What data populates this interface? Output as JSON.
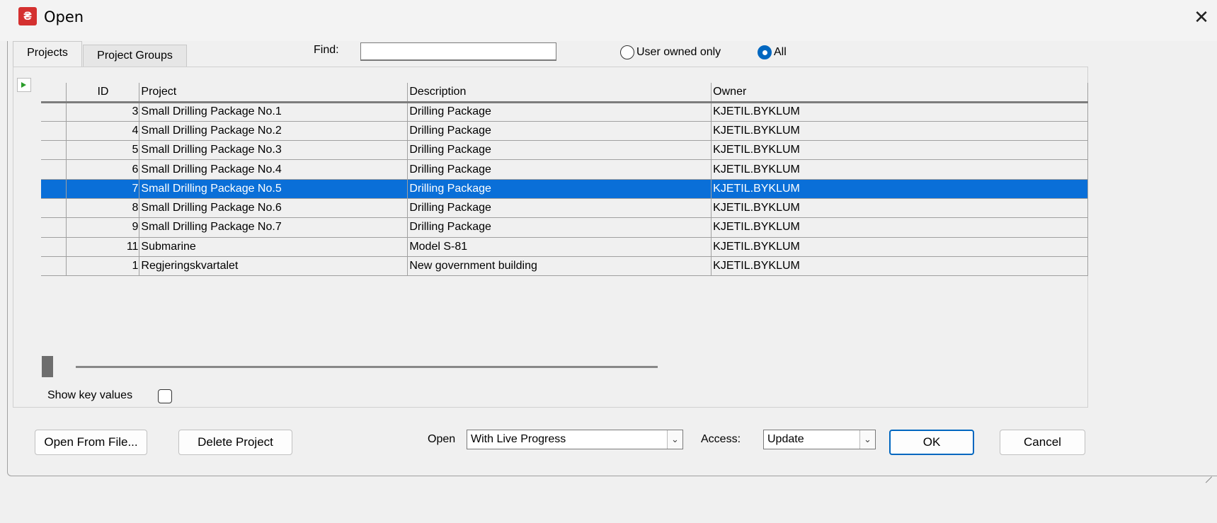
{
  "window": {
    "title": "Open",
    "app_icon_glyph": "₴",
    "close_glyph": "✕"
  },
  "tabs": [
    {
      "label": "Projects",
      "selected": true
    },
    {
      "label": "Project Groups",
      "selected": false
    }
  ],
  "find": {
    "label": "Find:",
    "value": ""
  },
  "filter": {
    "options": [
      {
        "label": "User owned only",
        "checked": false
      },
      {
        "label": "All",
        "checked": true
      }
    ]
  },
  "grid": {
    "columns": [
      "",
      "ID",
      "Project",
      "Description",
      "Owner"
    ],
    "rows": [
      {
        "id": "3",
        "project": "Small Drilling Package No.1",
        "description": "Drilling Package",
        "owner": "KJETIL.BYKLUM"
      },
      {
        "id": "4",
        "project": "Small Drilling Package No.2",
        "description": "Drilling Package",
        "owner": "KJETIL.BYKLUM"
      },
      {
        "id": "5",
        "project": "Small Drilling Package No.3",
        "description": "Drilling Package",
        "owner": "KJETIL.BYKLUM"
      },
      {
        "id": "6",
        "project": "Small Drilling Package No.4",
        "description": "Drilling Package",
        "owner": "KJETIL.BYKLUM"
      },
      {
        "id": "7",
        "project": "Small Drilling Package No.5",
        "description": "Drilling Package",
        "owner": "KJETIL.BYKLUM",
        "selected": true
      },
      {
        "id": "8",
        "project": "Small Drilling Package No.6",
        "description": "Drilling Package",
        "owner": "KJETIL.BYKLUM"
      },
      {
        "id": "9",
        "project": "Small Drilling Package No.7",
        "description": "Drilling Package",
        "owner": "KJETIL.BYKLUM"
      },
      {
        "id": "11",
        "project": "Submarine",
        "description": "Model S-81",
        "owner": "KJETIL.BYKLUM"
      },
      {
        "id": "1",
        "project": "Regjeringskvartalet",
        "description": "New government building",
        "owner": "KJETIL.BYKLUM"
      }
    ]
  },
  "show_key_values": {
    "label": "Show key values",
    "checked": false
  },
  "buttons": {
    "open_from_file": "Open From File...",
    "delete_project": "Delete Project",
    "ok": "OK",
    "cancel": "Cancel"
  },
  "open_mode": {
    "label": "Open",
    "value": "With Live Progress"
  },
  "access": {
    "label": "Access:",
    "value": "Update"
  },
  "colors": {
    "selection": "#0a6fd8",
    "accent": "#0067c0",
    "app_icon": "#d4302f"
  }
}
